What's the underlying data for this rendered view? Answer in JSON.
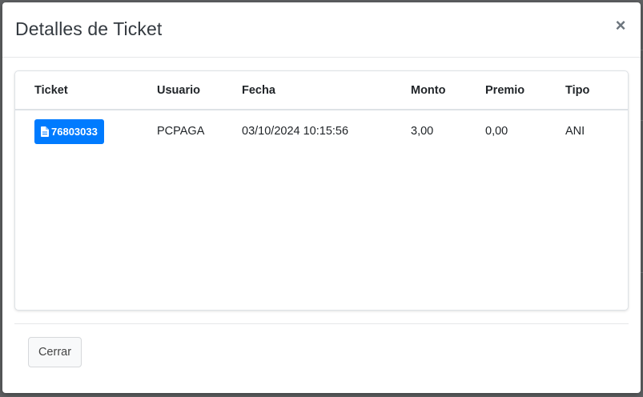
{
  "modal": {
    "title": "Detalles de Ticket",
    "close_symbol": "×",
    "close_button_label": "Cerrar"
  },
  "table": {
    "headers": {
      "ticket": "Ticket",
      "user": "Usuario",
      "date": "Fecha",
      "amount": "Monto",
      "prize": "Premio",
      "type": "Tipo"
    },
    "rows": [
      {
        "ticket": "76803033",
        "user": "PCPAGA",
        "date": "03/10/2024 10:15:56",
        "amount": "3,00",
        "prize": "0,00",
        "type": "ANI"
      }
    ]
  },
  "icons": {
    "ticket_icon": "file-icon"
  },
  "colors": {
    "primary": "#007bff",
    "backdrop": "#5f6163"
  }
}
